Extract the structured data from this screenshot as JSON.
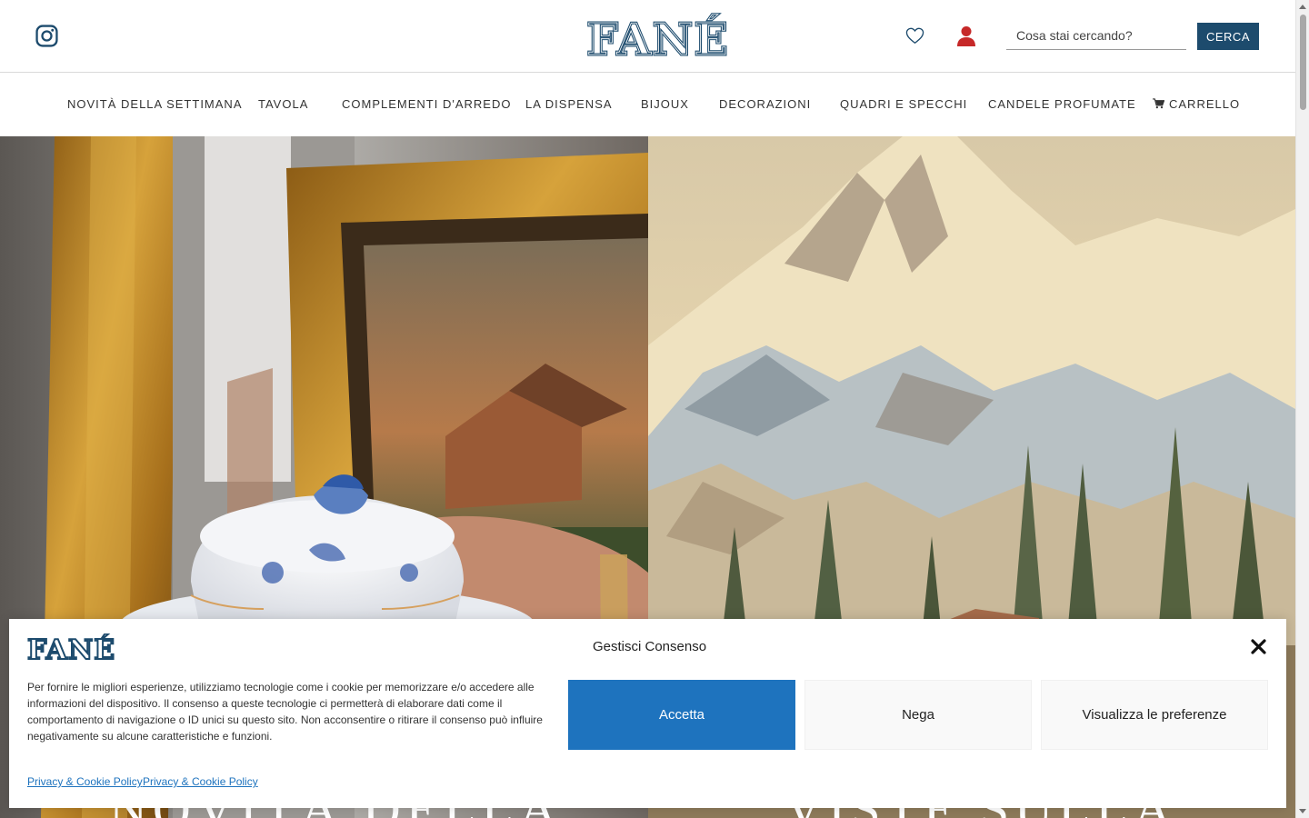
{
  "header": {
    "logo_text": "FANÉ",
    "search_placeholder": "Cosa stai cercando?",
    "search_button": "CERCA",
    "icons": [
      "instagram-icon",
      "heart-icon",
      "user-icon"
    ]
  },
  "nav": {
    "items": [
      {
        "label": "NOVITÀ DELLA SETTIMANA"
      },
      {
        "label": "TAVOLA"
      },
      {
        "label": "COMPLEMENTI D'ARREDO"
      },
      {
        "label": "LA DISPENSA"
      },
      {
        "label": "BIJOUX"
      },
      {
        "label": "DECORAZIONI"
      },
      {
        "label": "QUADRI E SPECCHI"
      },
      {
        "label": "CANDELE PROFUMATE"
      },
      {
        "label": "CARRELLO",
        "icon": "cart-icon"
      }
    ]
  },
  "hero": {
    "left_title": "NOVITÀ DELLA",
    "right_title": "VISTE SULLA"
  },
  "cookie": {
    "logo_text": "FANÉ",
    "title": "Gestisci Consenso",
    "text": "Per fornire le migliori esperienze, utilizziamo tecnologie come i cookie per memorizzare e/o accedere alle informazioni del dispositivo. Il consenso a queste tecnologie ci permetterà di elaborare dati come il comportamento di navigazione o ID unici su questo sito. Non acconsentire o ritirare il consenso può influire negativamente su alcune caratteristiche e funzioni.",
    "accept": "Accetta",
    "deny": "Nega",
    "preferences": "Visualizza le preferenze",
    "link1": "Privacy & Cookie Policy",
    "link2": "Privacy & Cookie Policy"
  },
  "colors": {
    "brand_navy": "#1d4b6d",
    "accept_blue": "#1e73be",
    "user_icon_red": "#c62828"
  }
}
